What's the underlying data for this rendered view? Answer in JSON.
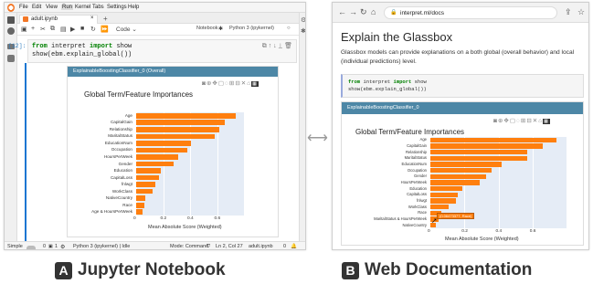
{
  "jupyter": {
    "menu": [
      "File",
      "Edit",
      "View",
      "Run",
      "Kernel",
      "Tabs",
      "Settings",
      "Help"
    ],
    "tab_label": "adult.ipynb",
    "toolbar": {
      "celltype": "Code",
      "kernel_label": "Notebook",
      "kernel_name": "Python 3 (ipykernel)"
    },
    "cell": {
      "prompt": "[12]:",
      "line1_kw1": "from",
      "line1_mid": " interpret ",
      "line1_kw2": "import",
      "line1_end": " show",
      "line2": "show(ebm.explain_global())"
    },
    "status": {
      "mode_simple": "Simple",
      "num1": "0",
      "num2": "1",
      "kernel": "Python 3 (ipykernel) | Idle",
      "mode": "Mode: Command",
      "pos": "Ln 2, Col 27",
      "file": "adult.ipynb",
      "num3": "0"
    }
  },
  "browser": {
    "url": "interpret.ml/docs",
    "heading": "Explain the Glassbox",
    "paragraph": "Glassbox models can provide explanations on a both global (overall behavior) and local (individual predictions) level.",
    "code_line1_kw1": "from",
    "code_line1_mid": " interpret ",
    "code_line1_kw2": "import",
    "code_line1_end": " show",
    "code_line2": "show(ebm.explain_global())",
    "card_header": "ExplainableBoostingClassifier_0",
    "tooltip": "(0.06473377, Race)"
  },
  "jupyter_card_header": "ExplainableBoostingClassifier_0 (Overall)",
  "captions": {
    "a_letter": "A",
    "a_text": "Jupyter Notebook",
    "b_letter": "B",
    "b_text": "Web Documentation"
  },
  "chart_data": [
    {
      "type": "bar",
      "orientation": "horizontal",
      "title": "Global Term/Feature Importances",
      "xlabel": "Mean Absolute Score (Weighted)",
      "ylabel": "",
      "categories": [
        "Age",
        "CapitalGain",
        "Relationship",
        "MaritalStatus",
        "EducationNum",
        "Occupation",
        "HoursPerWeek",
        "Gender",
        "Education",
        "CapitalLoss",
        "fnlwgt",
        "WorkClass",
        "NativeCountry",
        "Race",
        "Age & HoursPerWeek"
      ],
      "values": [
        0.74,
        0.66,
        0.62,
        0.58,
        0.41,
        0.38,
        0.31,
        0.28,
        0.18,
        0.17,
        0.14,
        0.12,
        0.07,
        0.06,
        0.05
      ],
      "xlim": [
        0,
        0.8
      ],
      "xticks": [
        "0",
        "0.2",
        "0.4",
        "0.6"
      ],
      "grid": true,
      "bar_color": "#ff7f0e"
    },
    {
      "type": "bar",
      "orientation": "horizontal",
      "title": "Global Term/Feature Importances",
      "xlabel": "Mean Absolute Score (Weighted)",
      "ylabel": "",
      "categories": [
        "Age",
        "CapitalGain",
        "Relationship",
        "MaritalStatus",
        "EducationNum",
        "Occupation",
        "Gender",
        "HoursPerWeek",
        "Education",
        "CapitalLoss",
        "fnlwgt",
        "WorkClass",
        "Race",
        "MaritalStatus & HoursPerWeek",
        "NativeCountry"
      ],
      "values": [
        0.74,
        0.66,
        0.57,
        0.57,
        0.42,
        0.36,
        0.33,
        0.29,
        0.19,
        0.16,
        0.15,
        0.11,
        0.065,
        0.05,
        0.03
      ],
      "xlim": [
        0,
        0.8
      ],
      "xticks": [
        "0",
        "0.2",
        "0.4",
        "0.6"
      ],
      "grid": true,
      "bar_color": "#ff7f0e"
    }
  ]
}
